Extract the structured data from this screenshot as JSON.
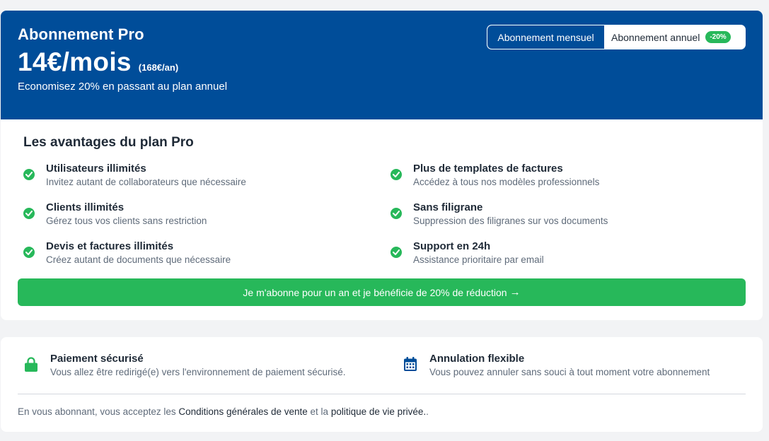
{
  "header": {
    "plan_name": "Abonnement Pro",
    "price": "14€/mois",
    "price_annual": "(168€/an)",
    "savings_text": "Economisez 20% en passant au plan annuel"
  },
  "billing_toggle": {
    "monthly_label": "Abonnement mensuel",
    "annual_label": "Abonnement annuel",
    "discount_badge": "-20%",
    "selected": "monthly"
  },
  "benefits": {
    "title": "Les avantages du plan Pro",
    "items": [
      {
        "title": "Utilisateurs illimités",
        "description": "Invitez autant de collaborateurs que nécessaire"
      },
      {
        "title": "Plus de templates de factures",
        "description": "Accédez à tous nos modèles professionnels"
      },
      {
        "title": "Clients illimités",
        "description": "Gérez tous vos clients sans restriction"
      },
      {
        "title": "Sans filigrane",
        "description": "Suppression des filigranes sur vos documents"
      },
      {
        "title": "Devis et factures illimités",
        "description": "Créez autant de documents que nécessaire"
      },
      {
        "title": "Support en 24h",
        "description": "Assistance prioritaire par email"
      }
    ]
  },
  "cta": {
    "label": "Je m'abonne pour un an et je bénéficie de 20% de réduction",
    "arrow": "→"
  },
  "assurances": [
    {
      "icon": "lock-icon",
      "title": "Paiement sécurisé",
      "description": "Vous allez être redirigé(e) vers l'environnement de paiement sécurisé."
    },
    {
      "icon": "calendar-icon",
      "title": "Annulation flexible",
      "description": "Vous pouvez annuler sans souci à tout moment votre abonnement"
    }
  ],
  "legal": {
    "prefix": "En vous abonnant, vous acceptez les ",
    "terms_link": "Conditions générales de vente",
    "middle": " et la ",
    "privacy_link": "politique de vie privée.",
    "suffix": "."
  },
  "colors": {
    "brand_blue": "#004d99",
    "success_green": "#27b85a",
    "background": "#f2f3f5"
  }
}
